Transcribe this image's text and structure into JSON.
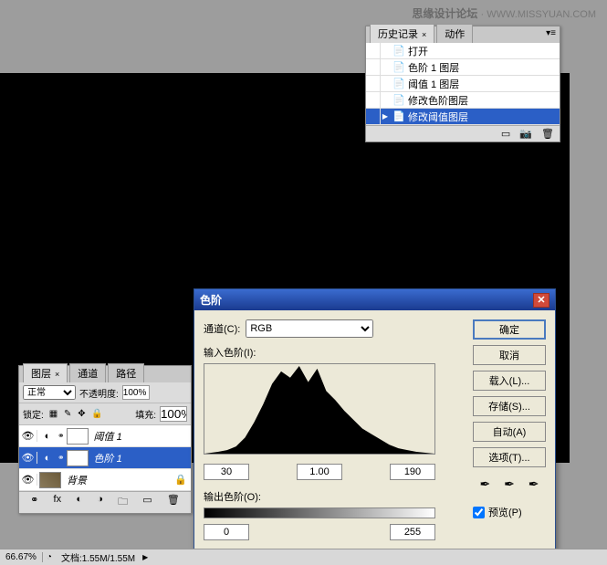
{
  "watermark": {
    "main": "思缘设计论坛",
    "sub": "· WWW.MISSYUAN.COM"
  },
  "history": {
    "tab_active": "历史记录",
    "tab_inactive": "动作",
    "items": [
      {
        "label": "打开",
        "icon": "📄",
        "selected": false,
        "play": ""
      },
      {
        "label": "色阶 1 图层",
        "icon": "📄",
        "selected": false,
        "play": ""
      },
      {
        "label": "阈值 1 图层",
        "icon": "📄",
        "selected": false,
        "play": ""
      },
      {
        "label": "修改色阶图层",
        "icon": "📄",
        "selected": false,
        "play": ""
      },
      {
        "label": "修改阈值图层",
        "icon": "📄",
        "selected": true,
        "play": "▶"
      }
    ]
  },
  "layers": {
    "tab_active": "图层",
    "tab2": "通道",
    "tab3": "路径",
    "blend_mode": "正常",
    "opacity_label": "不透明度:",
    "opacity_val": "100%",
    "lock_label": "锁定:",
    "fill_label": "填充:",
    "fill_val": "100%",
    "items": [
      {
        "name": "阈值 1",
        "selected": false,
        "adj": true
      },
      {
        "name": "色阶 1",
        "selected": true,
        "adj": true
      },
      {
        "name": "背景",
        "selected": false,
        "adj": false,
        "bg": true
      }
    ]
  },
  "status": {
    "zoom": "66.67%",
    "doc_label": "文档:",
    "doc_val": "1.55M/1.55M"
  },
  "levels": {
    "title": "色阶",
    "channel_label": "通道(C):",
    "channel_val": "RGB",
    "input_label": "输入色阶(I):",
    "output_label": "输出色阶(O):",
    "in_black": "30",
    "in_gamma": "1.00",
    "in_white": "190",
    "out_black": "0",
    "out_white": "255",
    "ok": "确定",
    "cancel": "取消",
    "load": "载入(L)...",
    "save": "存储(S)...",
    "auto": "自动(A)",
    "options": "选项(T)...",
    "preview": "预览(P)"
  },
  "chart_data": {
    "type": "area",
    "title": "输入色阶(I):",
    "xlabel": "",
    "ylabel": "",
    "xlim": [
      0,
      255
    ],
    "ylim": [
      0,
      100
    ],
    "x": [
      0,
      15,
      25,
      35,
      45,
      55,
      65,
      75,
      85,
      95,
      105,
      115,
      125,
      135,
      145,
      155,
      165,
      175,
      185,
      195,
      205,
      215,
      225,
      235,
      255
    ],
    "values": [
      0,
      2,
      4,
      8,
      18,
      35,
      55,
      78,
      92,
      85,
      98,
      80,
      95,
      70,
      60,
      48,
      38,
      28,
      22,
      16,
      10,
      6,
      4,
      2,
      0
    ]
  }
}
